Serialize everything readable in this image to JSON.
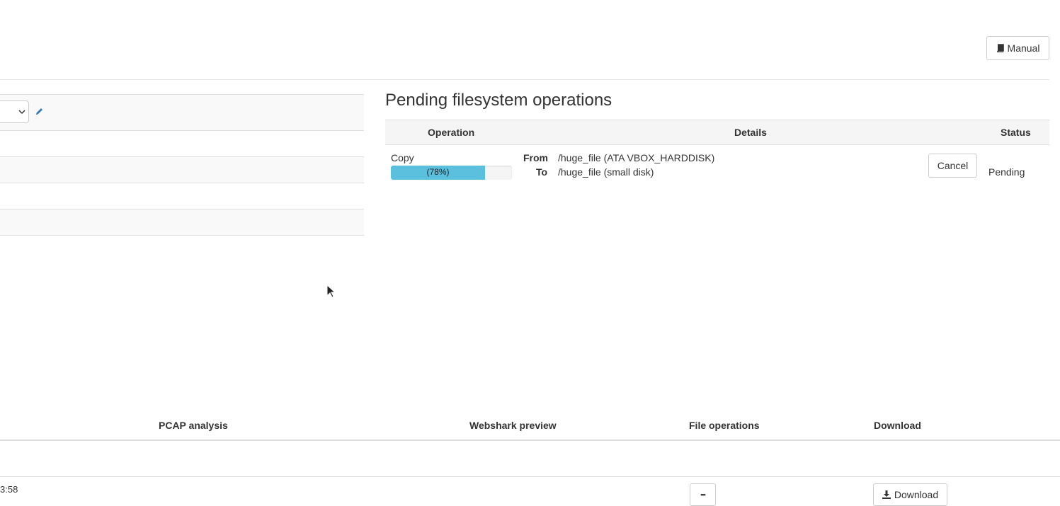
{
  "header": {
    "manual_button": "Manual",
    "manual_icon": "book-icon"
  },
  "left_panel": {
    "select_icon": "chevron-down-icon",
    "edit_icon": "pencil-icon"
  },
  "pending_ops": {
    "title": "Pending filesystem operations",
    "columns": {
      "operation": "Operation",
      "details": "Details",
      "status": "Status"
    },
    "row": {
      "operation": "Copy",
      "progress_percent": 78,
      "progress_label": "(78%)",
      "from_label": "From",
      "from_value": "/huge_file (ATA VBOX_HARDDISK)",
      "to_label": "To",
      "to_value": "/huge_file (small disk)",
      "cancel_button": "Cancel",
      "status": "Pending"
    },
    "progress_color": "#5bc0de"
  },
  "files_table": {
    "columns": {
      "pcap": "PCAP analysis",
      "webshark": "Webshark preview",
      "file_ops": "File operations",
      "download": "Download"
    },
    "row": {
      "time_fragment": "3:58",
      "more_button": "•••",
      "download_button": "Download",
      "download_icon": "download-icon"
    }
  }
}
